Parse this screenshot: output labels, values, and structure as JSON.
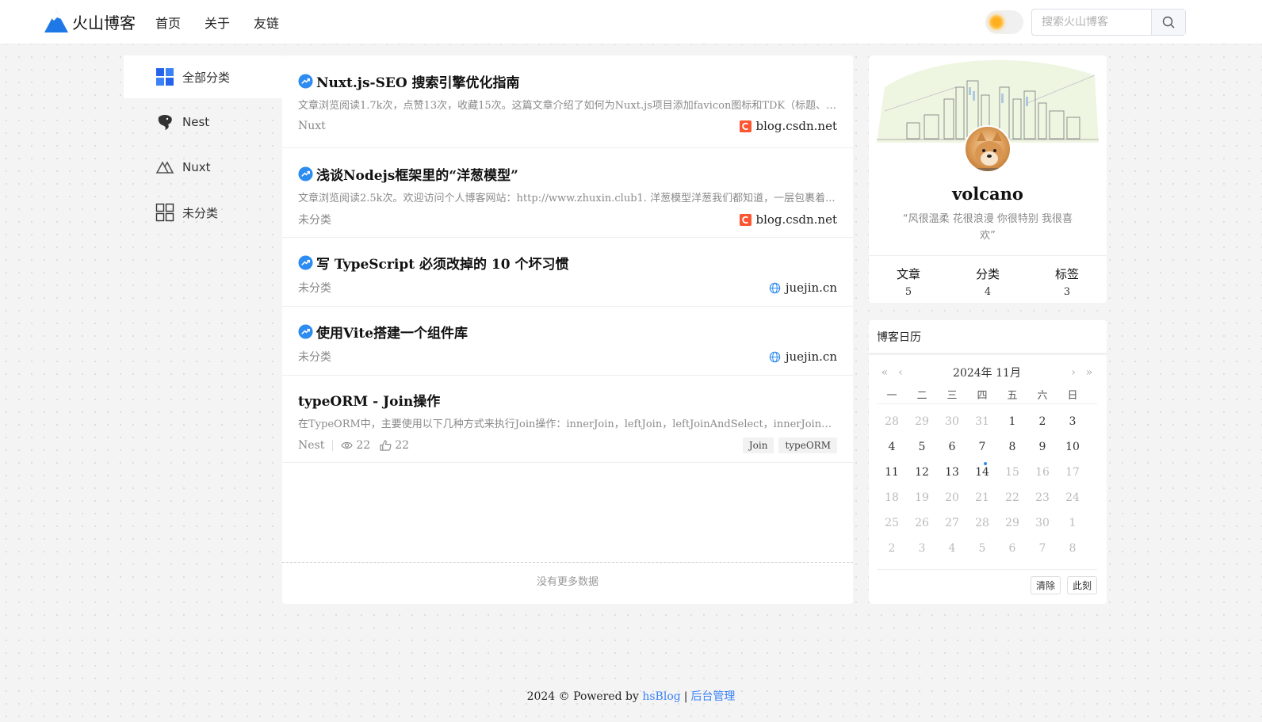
{
  "header": {
    "logo_text": "火山博客",
    "nav": [
      "首页",
      "关于",
      "友链"
    ],
    "search_placeholder": "搜索火山博客"
  },
  "categories": [
    {
      "label": "全部分类",
      "icon": "grid-blue-icon",
      "active": true
    },
    {
      "label": "Nest",
      "icon": "nest-icon",
      "active": false
    },
    {
      "label": "Nuxt",
      "icon": "nuxt-icon",
      "active": false
    },
    {
      "label": "未分类",
      "icon": "grid-outline-icon",
      "active": false
    }
  ],
  "articles": [
    {
      "title": "Nuxt.js-SEO 搜索引擎优化指南",
      "desc": "文章浏览阅读1.7k次，点赞13次，收藏15次。这篇文章介绍了如何为Nuxt.js项目添加favicon图标和TDK（标题、描...",
      "category": "Nuxt",
      "source": "blog.csdn.net",
      "source_icon": "csdn-icon"
    },
    {
      "title": "浅谈Nodejs框架里的“洋葱模型”",
      "desc": "文章浏览阅读2.5k次。欢迎访问个人博客网站：http://www.zhuxin.club1. 洋葱模型洋葱我们都知道，一层包裹着...",
      "category": "未分类",
      "source": "blog.csdn.net",
      "source_icon": "csdn-icon"
    },
    {
      "title": "写 TypeScript 必须改掉的 10 个坏习惯",
      "desc": "",
      "category": "未分类",
      "source": "juejin.cn",
      "source_icon": "globe-icon"
    },
    {
      "title": "使用Vite搭建一个组件库",
      "desc": "",
      "category": "未分类",
      "source": "juejin.cn",
      "source_icon": "globe-icon"
    },
    {
      "title": "typeORM - Join操作",
      "desc": "在TypeORM中，主要使用以下几种方式来执行Join操作：innerJoin，leftJoin，leftJoinAndSelect，innerJoinA...",
      "category": "Nest",
      "views": "22",
      "likes": "22",
      "tags": [
        "Join",
        "typeORM"
      ]
    }
  ],
  "no_more": "没有更多数据",
  "profile": {
    "name": "volcano",
    "motto": "“风很温柔 花很浪漫 你很特别 我很喜欢”",
    "stats": [
      {
        "label": "文章",
        "value": "5"
      },
      {
        "label": "分类",
        "value": "4"
      },
      {
        "label": "标签",
        "value": "3"
      }
    ]
  },
  "calendar": {
    "title": "博客日历",
    "month": "2024年 11月",
    "weekdays": [
      "一",
      "二",
      "三",
      "四",
      "五",
      "六",
      "日"
    ],
    "weeks": [
      [
        [
          "28",
          "off"
        ],
        [
          "29",
          "off"
        ],
        [
          "30",
          "off"
        ],
        [
          "31",
          "off"
        ],
        [
          "1",
          ""
        ],
        [
          "2",
          ""
        ],
        [
          "3",
          ""
        ]
      ],
      [
        [
          "4",
          ""
        ],
        [
          "5",
          ""
        ],
        [
          "6",
          ""
        ],
        [
          "7",
          ""
        ],
        [
          "8",
          ""
        ],
        [
          "9",
          ""
        ],
        [
          "10",
          ""
        ]
      ],
      [
        [
          "11",
          ""
        ],
        [
          "12",
          ""
        ],
        [
          "13",
          ""
        ],
        [
          "14",
          "today"
        ],
        [
          "15",
          "off"
        ],
        [
          "16",
          "off"
        ],
        [
          "17",
          "off"
        ]
      ],
      [
        [
          "18",
          "off"
        ],
        [
          "19",
          "off"
        ],
        [
          "20",
          "off"
        ],
        [
          "21",
          "off"
        ],
        [
          "22",
          "off"
        ],
        [
          "23",
          "off"
        ],
        [
          "24",
          "off"
        ]
      ],
      [
        [
          "25",
          "off"
        ],
        [
          "26",
          "off"
        ],
        [
          "27",
          "off"
        ],
        [
          "28",
          "off"
        ],
        [
          "29",
          "off"
        ],
        [
          "30",
          "off"
        ],
        [
          "1",
          "off"
        ]
      ],
      [
        [
          "2",
          "off"
        ],
        [
          "3",
          "off"
        ],
        [
          "4",
          "off"
        ],
        [
          "5",
          "off"
        ],
        [
          "6",
          "off"
        ],
        [
          "7",
          "off"
        ],
        [
          "8",
          "off"
        ]
      ]
    ],
    "clear_label": "清除",
    "now_label": "此刻"
  },
  "footer": {
    "text": "2024 © Powered by",
    "brand_link": "hsBlog",
    "admin_link": "后台管理"
  },
  "colors": {
    "accent": "#2d8cf0",
    "link": "#3b82f6",
    "csdn_red": "#fc5531"
  }
}
